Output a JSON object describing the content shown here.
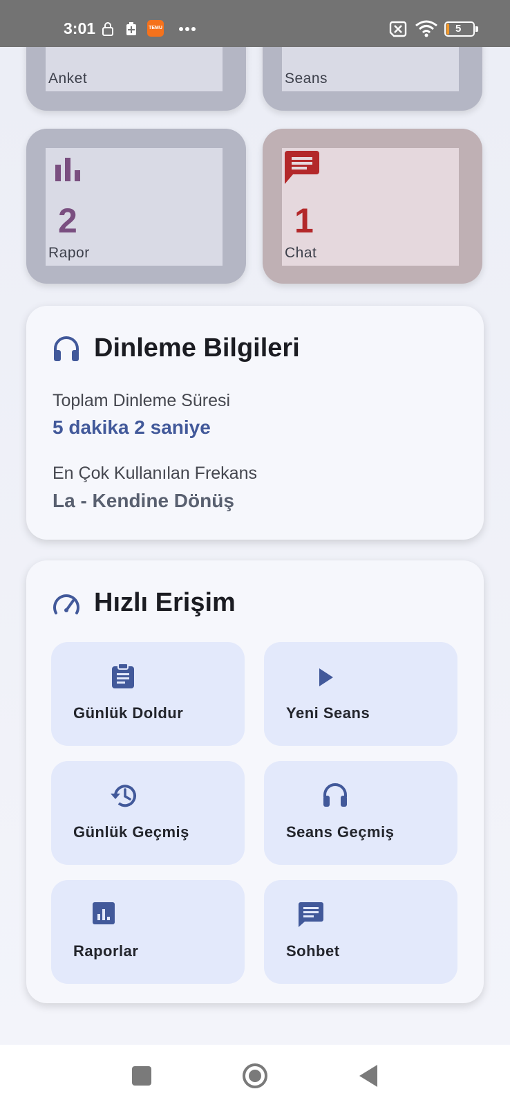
{
  "status_bar": {
    "time": "3:01",
    "battery": "5",
    "icons": [
      "lock-clock-icon",
      "battery-saver-icon",
      "temu-app-icon",
      "more-dots-icon",
      "no-sim-icon",
      "wifi-icon",
      "battery-icon"
    ],
    "temu_logo_text": "TEMU"
  },
  "stats": [
    {
      "label": "Anket",
      "icon": "survey"
    },
    {
      "label": "Seans",
      "icon": "session"
    },
    {
      "label": "Rapor",
      "value": "2",
      "icon": "bar-chart-icon",
      "color": "#7a4f80"
    },
    {
      "label": "Chat",
      "value": "1",
      "icon": "chat-icon",
      "color": "#b3282a"
    }
  ],
  "listening": {
    "title": "Dinleme Bilgileri",
    "icon": "headphones-icon",
    "total_label": "Toplam Dinleme Süresi",
    "total_value": "5 dakika 2 saniye",
    "freq_label": "En Çok Kullanılan Frekans",
    "freq_value": "La - Kendine Dönüş"
  },
  "quick_access": {
    "title": "Hızlı Erişim",
    "icon": "speedometer-icon",
    "buttons": [
      {
        "label": "Günlük Doldur",
        "icon": "clipboard-icon"
      },
      {
        "label": "Yeni Seans",
        "icon": "play-icon"
      },
      {
        "label": "Günlük Geçmiş",
        "icon": "history-icon"
      },
      {
        "label": "Seans Geçmiş",
        "icon": "headphones-icon"
      },
      {
        "label": "Raporlar",
        "icon": "report-chart-icon"
      },
      {
        "label": "Sohbet",
        "icon": "message-icon"
      }
    ]
  },
  "navbar": {
    "items": [
      "recent-apps-button",
      "home-button",
      "back-button"
    ]
  },
  "colors": {
    "accent": "#42599a",
    "freq_value": "#596070",
    "rapor": "#7a4f80",
    "chat": "#b3282a",
    "status_bar": "#737373"
  }
}
